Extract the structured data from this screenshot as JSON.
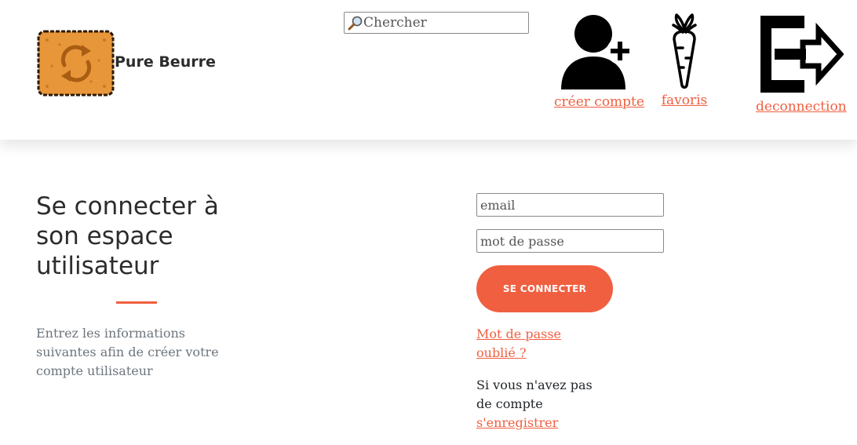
{
  "header": {
    "brand": "Pure Beurre",
    "search": {
      "placeholder": "Chercher"
    },
    "nav": {
      "create_account": "créer compte",
      "favorites": "favoris",
      "logout": "deconnection"
    }
  },
  "main": {
    "title": "Se connecter à son espace utilisateur",
    "intro": "Entrez les informations suivantes afin de créer votre compte utilisateur",
    "form": {
      "email_placeholder": "email",
      "password_placeholder": "mot de passe",
      "submit_label": "se connecter",
      "forgot_link": "Mot de passe oublié ?",
      "no_account_text": "Si vous n'avez pas de compte",
      "register_link": "s'enregistrer"
    }
  },
  "icons": {
    "logo": "biscuit-logo-icon",
    "search": "magnifier-icon",
    "create_account": "user-plus-icon",
    "favorites": "carrot-icon",
    "logout": "sign-out-icon"
  },
  "colors": {
    "accent": "#f05f40",
    "biscuit": "#e8963a",
    "biscuit_dark": "#a85d12",
    "text_dark": "#2c2c2c",
    "text_muted": "#6c757d"
  }
}
